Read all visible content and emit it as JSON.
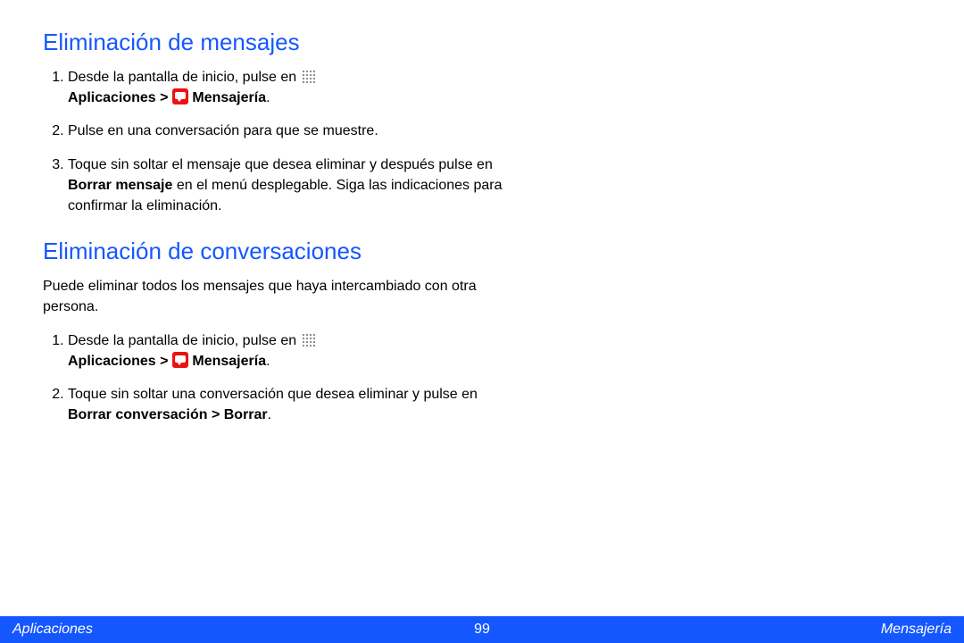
{
  "section1": {
    "title": "Eliminación de mensajes",
    "steps": [
      {
        "pre": "Desde la pantalla de inicio, pulse en ",
        "apps": "Aplicaciones > ",
        "msg": " Mensajería",
        "post": "."
      },
      {
        "text": "Pulse en una conversación para que se muestre."
      },
      {
        "pre": "Toque sin soltar el mensaje que desea eliminar y después pulse en ",
        "bold": "Borrar mensaje",
        "post": " en el menú desplegable. Siga las indicaciones para confirmar la eliminación."
      }
    ]
  },
  "section2": {
    "title": "Eliminación de conversaciones",
    "intro": "Puede eliminar todos los mensajes que haya intercambiado con otra persona.",
    "steps": [
      {
        "pre": "Desde la pantalla de inicio, pulse en ",
        "apps": "Aplicaciones > ",
        "msg": " Mensajería",
        "post": "."
      },
      {
        "pre": "Toque sin soltar una conversación que desea eliminar y pulse en ",
        "bold": "Borrar conversación > Borrar",
        "post": "."
      }
    ]
  },
  "footer": {
    "left": "Aplicaciones",
    "page": "99",
    "right": "Mensajería"
  }
}
